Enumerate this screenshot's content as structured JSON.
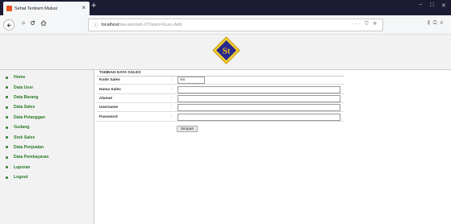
{
  "browser": {
    "tab_title": "Sehat Tentrem Mulusi",
    "tab_close": "×",
    "new_tab": "+",
    "url_host": "localhost",
    "url_path": "/sia-sekolah-2/?open=Guru-Add",
    "url_more": "··· ",
    "win_min": "−",
    "win_max": "□",
    "win_close": "✕"
  },
  "colors": {
    "menu_text": "#2a7a2a",
    "tabbar": "#1c1b33",
    "logo_bg": "#2a2a8a",
    "logo_text": "#f0c020"
  },
  "logo": {
    "text": "St"
  },
  "sidebar": {
    "items": [
      {
        "label": "Home"
      },
      {
        "label": "Data User"
      },
      {
        "label": "Data Barang"
      },
      {
        "label": "Data Sales"
      },
      {
        "label": "Data Pelanggan"
      },
      {
        "label": "Gudang"
      },
      {
        "label": "Stok Sales"
      },
      {
        "label": "Data Penjualan"
      },
      {
        "label": "Data Pembayaran"
      },
      {
        "label": "Laporan"
      },
      {
        "label": "Logout"
      }
    ]
  },
  "form": {
    "title": "TAMBAH DATA SALES",
    "colon": ":",
    "fields": [
      {
        "label": "Kode Sales",
        "value": "A4"
      },
      {
        "label": "Nama Sales",
        "value": ""
      },
      {
        "label": "Alamat",
        "value": ""
      },
      {
        "label": "Username",
        "value": ""
      },
      {
        "label": "Password",
        "value": ""
      }
    ],
    "submit_label": "Simpan"
  }
}
